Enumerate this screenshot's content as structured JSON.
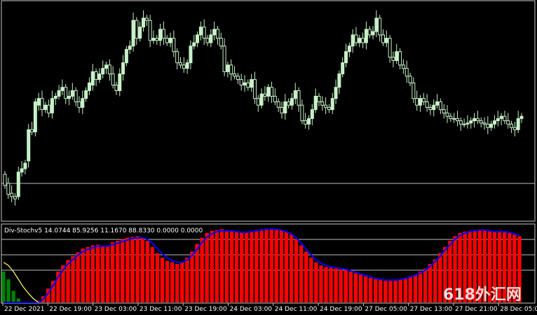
{
  "indicator_label": "Div-Stochv5 14.0744 85.9256 11.1670 88.8330 0.0000 0.0000",
  "watermark": "618外汇网",
  "colors": {
    "background": "#000000",
    "frame": "#c8c8c8",
    "bull_candle": "#c8f0c8",
    "bear_candle": "#000000",
    "wick": "#c8f0c8",
    "level_line": "#c0c0c0",
    "hist_red": "#ff0000",
    "hist_green": "#008000",
    "signal_line": "#0000ff",
    "yellow_line": "#ffff66"
  },
  "chart_data": [
    {
      "type": "candlestick",
      "title": "",
      "x_time_labels": [
        "22 Dec 2021",
        "22 Dec 19:00",
        "23 Dec 03:00",
        "23 Dec 11:00",
        "23 Dec 19:00",
        "24 Dec 03:00",
        "24 Dec 11:00",
        "24 Dec 19:00",
        "27 Dec 05:00",
        "27 Dec 13:00",
        "27 Dec 21:00",
        "28 Dec 05:00"
      ],
      "grid": false,
      "close": [
        40,
        32,
        30,
        28,
        52,
        55,
        60,
        90,
        88,
        115,
        118,
        108,
        112,
        105,
        118,
        120,
        125,
        128,
        118,
        120,
        125,
        115,
        110,
        118,
        125,
        132,
        142,
        135,
        140,
        145,
        148,
        140,
        130,
        125,
        140,
        150,
        162,
        165,
        188,
        172,
        182,
        190,
        188,
        170,
        172,
        170,
        180,
        172,
        168,
        172,
        160,
        150,
        148,
        145,
        150,
        165,
        168,
        175,
        182,
        172,
        168,
        175,
        180,
        172,
        165,
        142,
        148,
        140,
        138,
        135,
        130,
        132,
        128,
        135,
        118,
        112,
        122,
        120,
        128,
        120,
        115,
        110,
        105,
        115,
        112,
        118,
        125,
        112,
        98,
        95,
        100,
        108,
        120,
        115,
        112,
        110,
        108,
        118,
        128,
        140,
        150,
        160,
        165,
        175,
        168,
        172,
        168,
        180,
        175,
        178,
        190,
        175,
        168,
        172,
        155,
        152,
        160,
        148,
        145,
        138,
        132,
        118,
        112,
        118,
        115,
        110,
        108,
        112,
        115,
        108,
        105,
        102,
        100,
        100,
        98,
        95,
        95,
        96,
        98,
        100,
        98,
        96,
        95,
        92,
        95,
        98,
        100,
        102,
        98,
        95,
        92,
        90,
        100,
        102
      ],
      "open": [
        50,
        42,
        33,
        30,
        30,
        52,
        55,
        62,
        90,
        88,
        112,
        118,
        108,
        112,
        105,
        118,
        120,
        125,
        128,
        118,
        120,
        125,
        115,
        110,
        118,
        125,
        130,
        142,
        135,
        140,
        145,
        148,
        140,
        130,
        125,
        140,
        150,
        162,
        165,
        188,
        172,
        182,
        190,
        188,
        170,
        172,
        170,
        180,
        172,
        168,
        172,
        160,
        150,
        148,
        145,
        150,
        165,
        168,
        175,
        182,
        172,
        168,
        175,
        180,
        172,
        165,
        142,
        148,
        140,
        138,
        135,
        130,
        132,
        128,
        135,
        118,
        112,
        122,
        120,
        128,
        120,
        115,
        110,
        105,
        115,
        112,
        118,
        125,
        112,
        98,
        95,
        100,
        108,
        120,
        115,
        112,
        110,
        108,
        118,
        128,
        140,
        150,
        160,
        165,
        175,
        168,
        172,
        168,
        180,
        175,
        178,
        190,
        175,
        168,
        172,
        155,
        152,
        160,
        148,
        145,
        138,
        132,
        118,
        112,
        118,
        115,
        110,
        108,
        112,
        115,
        108,
        105,
        102,
        100,
        100,
        98,
        95,
        95,
        96,
        98,
        100,
        98,
        96,
        95,
        92,
        95,
        98,
        100,
        102,
        98,
        95,
        92,
        90,
        100
      ]
    },
    {
      "type": "bar",
      "title": "Div-Stochv5",
      "ylim": [
        0,
        100
      ],
      "levels": [
        80,
        50,
        20
      ],
      "series": [
        {
          "color": "red",
          "values": [
            0,
            0,
            0,
            0,
            0,
            0,
            0,
            2,
            8,
            18,
            28,
            40,
            48,
            55,
            60,
            65,
            70,
            72,
            74,
            75,
            73,
            74,
            78,
            80,
            82,
            84,
            85,
            86,
            84,
            80,
            72,
            64,
            58,
            54,
            52,
            50,
            52,
            58,
            66,
            76,
            84,
            90,
            93,
            94,
            95,
            94,
            93,
            92,
            91,
            92,
            93,
            94,
            95,
            96,
            96,
            95,
            94,
            92,
            88,
            82,
            74,
            66,
            58,
            52,
            48,
            46,
            45,
            44,
            43,
            42,
            40,
            38,
            36,
            34,
            32,
            30,
            29,
            28,
            28,
            29,
            30,
            32,
            34,
            36,
            40,
            44,
            50,
            56,
            64,
            72,
            80,
            86,
            90,
            92,
            93,
            94,
            95,
            94,
            93,
            92,
            93,
            92,
            90,
            88,
            86
          ]
        },
        {
          "color": "green",
          "values": [
            40,
            30,
            15,
            5
          ]
        }
      ],
      "lines": [
        {
          "color": "blue",
          "values": [
            0,
            0,
            0,
            0,
            0,
            0,
            0,
            0,
            4,
            12,
            22,
            33,
            42,
            50,
            56,
            61,
            66,
            69,
            71,
            73,
            73,
            73,
            75,
            77,
            79,
            81,
            83,
            84,
            84,
            82,
            77,
            70,
            63,
            58,
            54,
            52,
            52,
            55,
            61,
            69,
            78,
            85,
            89,
            92,
            93,
            93,
            93,
            92,
            91,
            91,
            92,
            93,
            94,
            95,
            95,
            95,
            94,
            92,
            89,
            84,
            77,
            69,
            62,
            55,
            51,
            48,
            46,
            45,
            44,
            43,
            41,
            39,
            37,
            35,
            33,
            31,
            30,
            29,
            29,
            29,
            30,
            31,
            33,
            35,
            38,
            42,
            47,
            53,
            60,
            68,
            75,
            82,
            87,
            90,
            92,
            93,
            94,
            94,
            93,
            92,
            92,
            92,
            91,
            89,
            87
          ]
        },
        {
          "color": "yellow",
          "values": [
            52,
            48,
            40,
            30,
            20,
            12,
            5,
            0
          ]
        }
      ]
    }
  ]
}
